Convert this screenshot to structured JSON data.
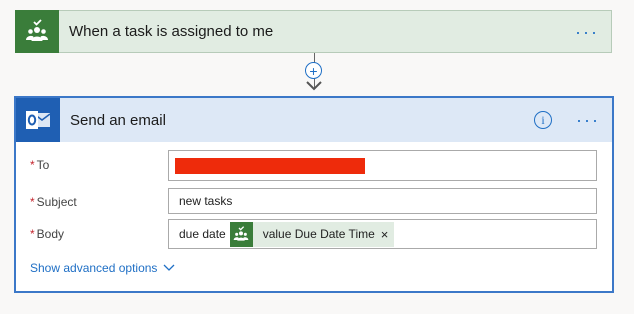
{
  "trigger": {
    "title": "When a task is assigned to me",
    "icon": "planner-task-icon",
    "menu": "···"
  },
  "connector": {
    "add": "+"
  },
  "action": {
    "title": "Send an email",
    "icon": "outlook-icon",
    "info": "i",
    "menu": "···",
    "fields": {
      "to": {
        "label": "To",
        "required": "*",
        "value_redacted": true
      },
      "subject": {
        "label": "Subject",
        "required": "*",
        "value": "new tasks"
      },
      "body": {
        "label": "Body",
        "required": "*",
        "text": "due date",
        "token": {
          "label": "value Due Date Time",
          "remove": "×"
        }
      }
    },
    "advanced_label": "Show advanced options"
  },
  "colors": {
    "accent": "#1f6fc5",
    "planner_green": "#3a7d3a",
    "outlook_blue": "#1f5fb3",
    "required": "#c4262e",
    "redaction": "#ee2b0b"
  }
}
